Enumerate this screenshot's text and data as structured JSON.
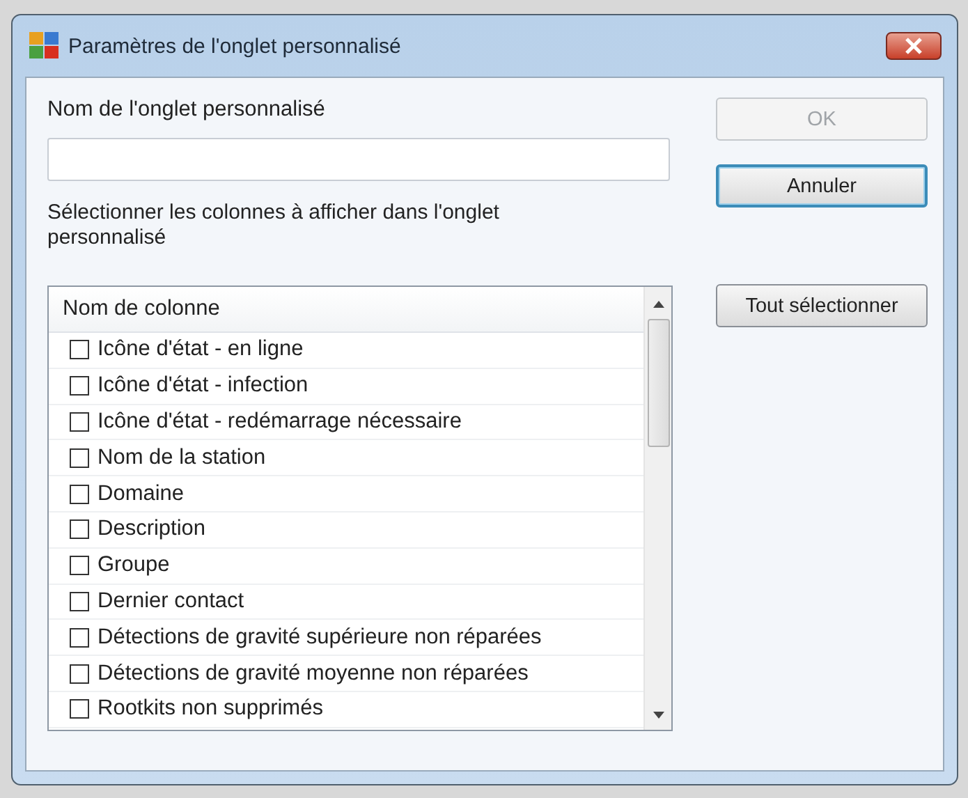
{
  "window": {
    "title": "Paramètres de l'onglet personnalisé"
  },
  "name_field": {
    "label": "Nom de l'onglet personnalisé"
  },
  "columns_label": "Sélectionner les colonnes à afficher dans l'onglet personnalisé",
  "columns_list": {
    "header": "Nom de colonne",
    "items": [
      {
        "label": "Icône d'état - en ligne",
        "checked": false
      },
      {
        "label": "Icône d'état - infection",
        "checked": false
      },
      {
        "label": "Icône d'état - redémarrage nécessaire",
        "checked": false
      },
      {
        "label": "Nom de la station",
        "checked": false
      },
      {
        "label": "Domaine",
        "checked": false
      },
      {
        "label": "Description",
        "checked": false
      },
      {
        "label": "Groupe",
        "checked": false
      },
      {
        "label": "Dernier contact",
        "checked": false
      },
      {
        "label": "Détections de gravité supérieure non réparées",
        "checked": false
      },
      {
        "label": "Détections de gravité moyenne non réparées",
        "checked": false
      },
      {
        "label": "Rootkits non supprimés",
        "checked": false
      }
    ]
  },
  "buttons": [
    {
      "label": "OK",
      "disabled": true,
      "focused": false
    },
    {
      "label": "Annuler",
      "disabled": false,
      "focused": true
    },
    {
      "label": "Tout sélectionner",
      "disabled": false,
      "focused": false
    }
  ]
}
